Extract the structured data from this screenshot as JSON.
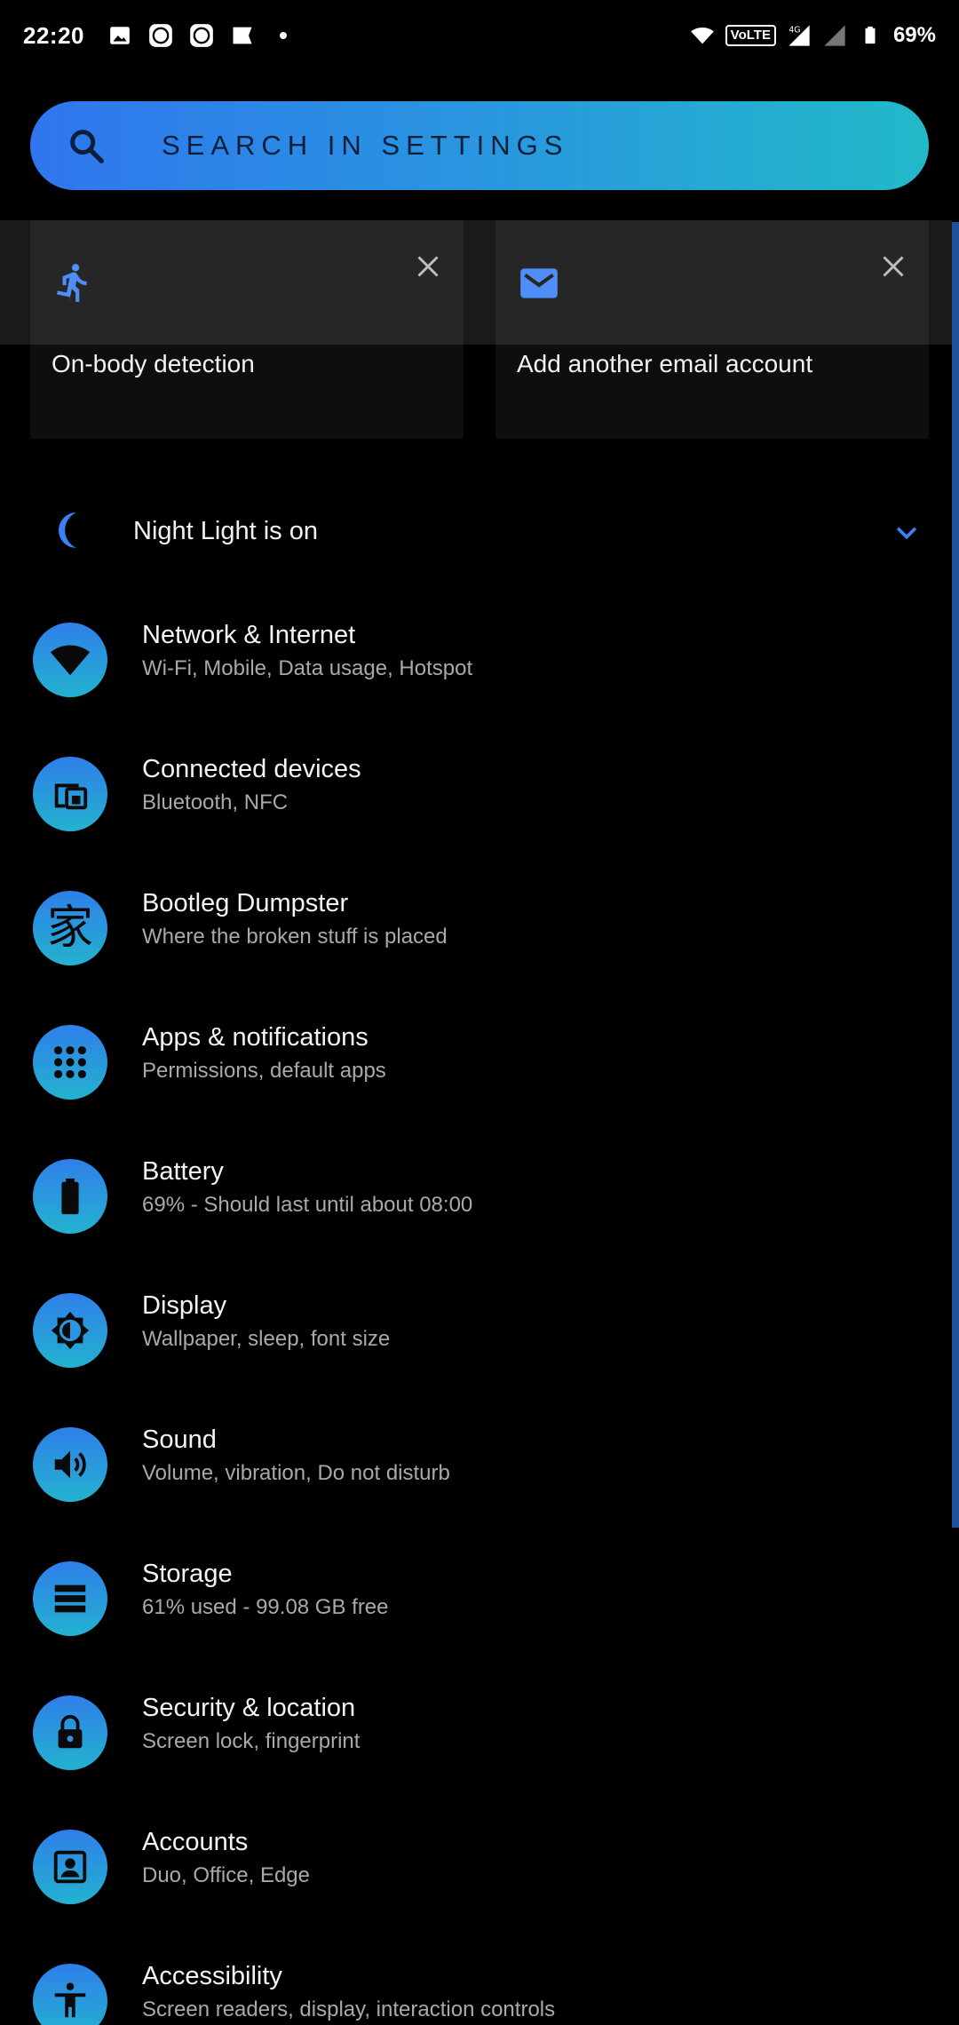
{
  "status_bar": {
    "time": "22:20",
    "left_icons": [
      "image-icon",
      "app-badge-icon",
      "app-badge-icon",
      "flag-icon",
      "dot-icon"
    ],
    "volte": "VoLTE",
    "network": "4G",
    "battery": "69%"
  },
  "search": {
    "placeholder": "SEARCH IN SETTINGS",
    "icon": "search-icon"
  },
  "suggestions": [
    {
      "title": "On-body detection",
      "icon": "walking-person-icon"
    },
    {
      "title": "Add another email account",
      "icon": "email-icon"
    }
  ],
  "night_light": {
    "label": "Night Light is on",
    "icon": "moon-icon"
  },
  "settings": [
    {
      "title": "Network & Internet",
      "subtitle": "Wi-Fi, Mobile, Data usage, Hotspot",
      "icon": "wifi-icon"
    },
    {
      "title": "Connected devices",
      "subtitle": "Bluetooth, NFC",
      "icon": "devices-icon"
    },
    {
      "title": "Bootleg Dumpster",
      "subtitle": "Where the broken stuff is placed",
      "icon": "chinese-char-icon",
      "glyph": "家"
    },
    {
      "title": "Apps & notifications",
      "subtitle": "Permissions, default apps",
      "icon": "apps-grid-icon"
    },
    {
      "title": "Battery",
      "subtitle": "69% - Should last until about 08:00",
      "icon": "battery-icon"
    },
    {
      "title": "Display",
      "subtitle": "Wallpaper, sleep, font size",
      "icon": "brightness-icon"
    },
    {
      "title": "Sound",
      "subtitle": "Volume, vibration, Do not disturb",
      "icon": "volume-icon"
    },
    {
      "title": "Storage",
      "subtitle": "61% used - 99.08 GB free",
      "icon": "storage-icon"
    },
    {
      "title": "Security & location",
      "subtitle": "Screen lock, fingerprint",
      "icon": "lock-icon"
    },
    {
      "title": "Accounts",
      "subtitle": "Duo, Office, Edge",
      "icon": "account-icon"
    },
    {
      "title": "Accessibility",
      "subtitle": "Screen readers, display, interaction controls",
      "icon": "accessibility-icon"
    }
  ],
  "colors": {
    "accent": "#2f76ee",
    "accent_end": "#22b9c9",
    "background": "#000000"
  }
}
